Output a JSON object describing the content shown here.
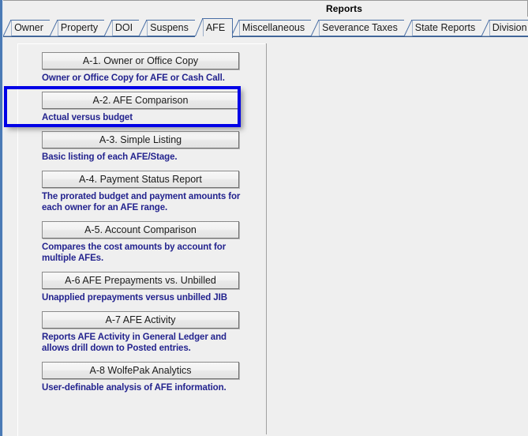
{
  "window": {
    "title": "Reports",
    "accent_blue": "#4a7ab5",
    "highlight_color": "#0000e6",
    "description_color": "#23238e",
    "background": "#efefef"
  },
  "tabs": [
    {
      "label": "Owner",
      "active": false
    },
    {
      "label": "Property",
      "active": false
    },
    {
      "label": "DOI",
      "active": false
    },
    {
      "label": "Suspens",
      "active": false
    },
    {
      "label": "AFE",
      "active": true
    },
    {
      "label": "Miscellaneous",
      "active": false
    },
    {
      "label": "Severance Taxes",
      "active": false
    },
    {
      "label": "State Reports",
      "active": false
    },
    {
      "label": "Division Orders",
      "active": false
    }
  ],
  "reports": [
    {
      "button": "A-1. Owner or Office Copy",
      "description": "Owner or Office Copy for AFE or Cash Call.",
      "selected": false
    },
    {
      "button": "A-2. AFE Comparison",
      "description": "Actual versus budget",
      "selected": true
    },
    {
      "button": "A-3. Simple Listing",
      "description": "Basic listing of each AFE/Stage.",
      "selected": false
    },
    {
      "button": "A-4. Payment Status Report",
      "description": "The prorated budget and payment amounts for each owner for an AFE range.",
      "selected": false
    },
    {
      "button": "A-5. Account Comparison",
      "description": "Compares the cost amounts by account for multiple AFEs.",
      "selected": false
    },
    {
      "button": "A-6 AFE Prepayments vs. Unbilled",
      "description": "Unapplied prepayments versus unbilled JIB",
      "selected": false
    },
    {
      "button": "A-7 AFE Activity",
      "description": "Reports AFE Activity in General Ledger and allows drill down to Posted entries.",
      "selected": false
    },
    {
      "button": "A-8 WolfePak Analytics",
      "description": "User-definable analysis of AFE information.",
      "selected": false
    }
  ]
}
